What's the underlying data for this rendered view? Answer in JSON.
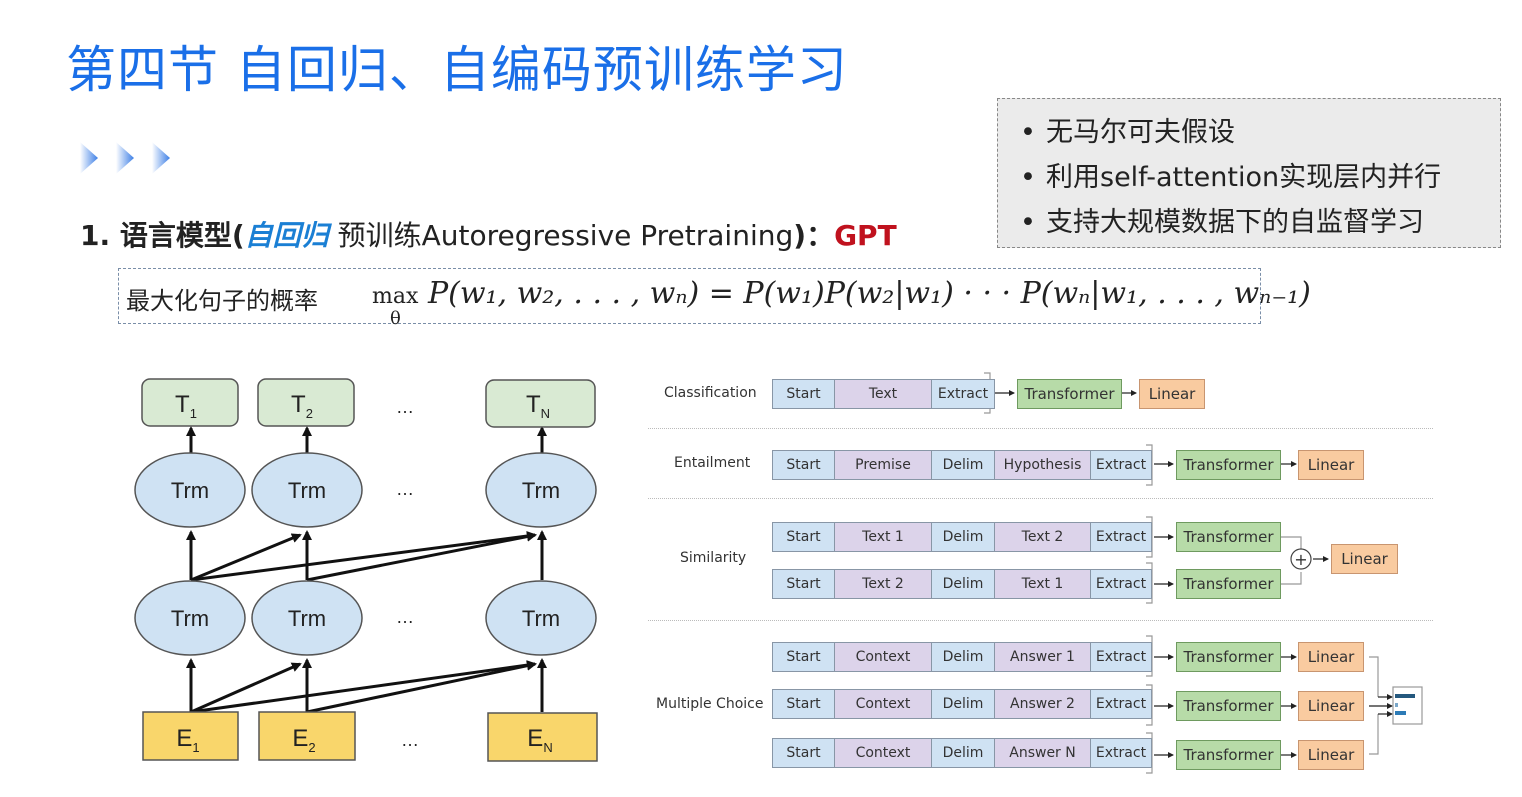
{
  "slide": {
    "title": "第四节 自回归、自编码预训练学习",
    "heading": {
      "prefix": "1. 语言模型(",
      "italic": "自回归",
      "regular": " 预训练Autoregressive Pretraining",
      "suffix": ")：",
      "model": "GPT"
    },
    "formula": {
      "label": "最大化句子的概率",
      "max": "max",
      "theta": "θ",
      "expression": "P(w₁, w₂, . . . , wₙ) = P(w₁)P(w₂|w₁) · · · P(wₙ|w₁, . . . , wₙ₋₁)"
    },
    "bullets": [
      "无马尔可夫假设",
      "利用self-attention实现层内并行",
      "支持大规模数据下的自监督学习"
    ],
    "colors": {
      "title": "#1a6fe8",
      "italic": "#1a7fd4",
      "gpt": "#c0121e",
      "node_green": "#d9ead3",
      "node_blue": "#cfe2f3",
      "node_yellow": "#f9d66b"
    }
  },
  "gpt_diagram": {
    "outputs": [
      "T",
      "T",
      "T"
    ],
    "output_subs": [
      "1",
      "2",
      "N"
    ],
    "layer_label": "Trm",
    "inputs": [
      "E",
      "E",
      "E"
    ],
    "input_subs": [
      "1",
      "2",
      "N"
    ],
    "ellipsis": "…"
  },
  "finetune_diagram": {
    "tasks": [
      {
        "name": "Classification",
        "rows": [
          [
            "Start",
            "Text",
            "Extract"
          ]
        ],
        "heads": [
          "Transformer",
          "Linear"
        ]
      },
      {
        "name": "Entailment",
        "rows": [
          [
            "Start",
            "Premise",
            "Delim",
            "Hypothesis",
            "Extract"
          ]
        ],
        "heads": [
          "Transformer",
          "Linear"
        ]
      },
      {
        "name": "Similarity",
        "rows": [
          [
            "Start",
            "Text 1",
            "Delim",
            "Text 2",
            "Extract"
          ],
          [
            "Start",
            "Text 2",
            "Delim",
            "Text 1",
            "Extract"
          ]
        ],
        "heads": [
          "Transformer",
          "Linear"
        ],
        "combine": "+"
      },
      {
        "name": "Multiple Choice",
        "rows": [
          [
            "Start",
            "Context",
            "Delim",
            "Answer 1",
            "Extract"
          ],
          [
            "Start",
            "Context",
            "Delim",
            "Answer 2",
            "Extract"
          ],
          [
            "Start",
            "Context",
            "Delim",
            "Answer N",
            "Extract"
          ]
        ],
        "heads": [
          "Transformer",
          "Linear"
        ]
      }
    ]
  }
}
